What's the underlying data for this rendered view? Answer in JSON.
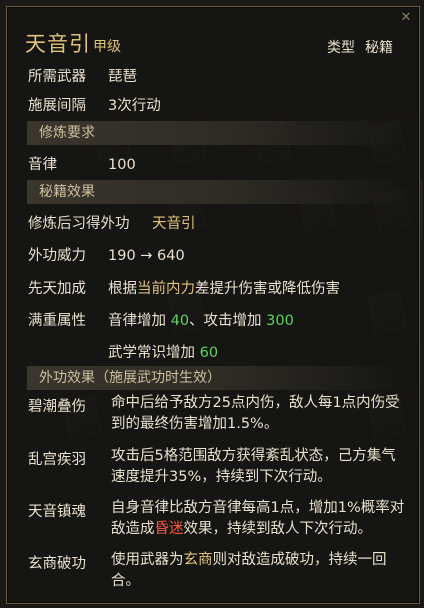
{
  "title": "天音引",
  "grade": "甲级",
  "type_label": "类型",
  "type_value": "秘籍",
  "info": [
    {
      "label": "所需武器",
      "value": "琵琶"
    },
    {
      "label": "施展间隔",
      "value": "3次行动"
    }
  ],
  "section_practice": "修炼要求",
  "req_label": "音律",
  "req_value": "100",
  "section_effect": "秘籍效果",
  "learn_label": "修炼后习得外功",
  "learn_value": "天音引",
  "power_label": "外功威力",
  "power_value": "190 → 640",
  "innate_label": "先天加成",
  "innate_p1": "根据",
  "innate_hl": "当前内力",
  "innate_p2": "差提升伤害或降低伤害",
  "full_label": "满重属性",
  "full_a": "音律增加 ",
  "full_a_val": "40",
  "full_b": "、攻击增加 ",
  "full_b_val": "300",
  "full_c": "武学常识增加 ",
  "full_c_val": "60",
  "section_external": "外功效果（施展武功时生效）",
  "effects": [
    {
      "name": "碧潮叠伤",
      "l1": "命中后给予敌方25点内伤，敌人每1点内伤受",
      "l2": "到的最终伤害增加1.5%。"
    },
    {
      "name": "乱宫疾羽",
      "l1": "攻击后5格范围敌方获得紊乱状态，己方集气",
      "l2": "速度提升35%，持续到下次行动。"
    },
    {
      "name": "天音镇魂",
      "l1": "自身音律比敌方音律每高1点，增加1%概率对",
      "l2a": "敌造成",
      "l2_hl": "昏迷",
      "l2b": "效果，持续到敌人下次行动。"
    },
    {
      "name": "玄商破功",
      "l1a": "使用武器为",
      "l1_hl": "玄商",
      "l1b": "则对敌造成破功，持续一回",
      "l2": "合。"
    }
  ],
  "colors": {
    "gold": "#e0c27a",
    "green": "#5fd45f",
    "red": "#ff5a3c",
    "border": "#6a5b40"
  },
  "icons": {
    "close": "close-icon"
  }
}
